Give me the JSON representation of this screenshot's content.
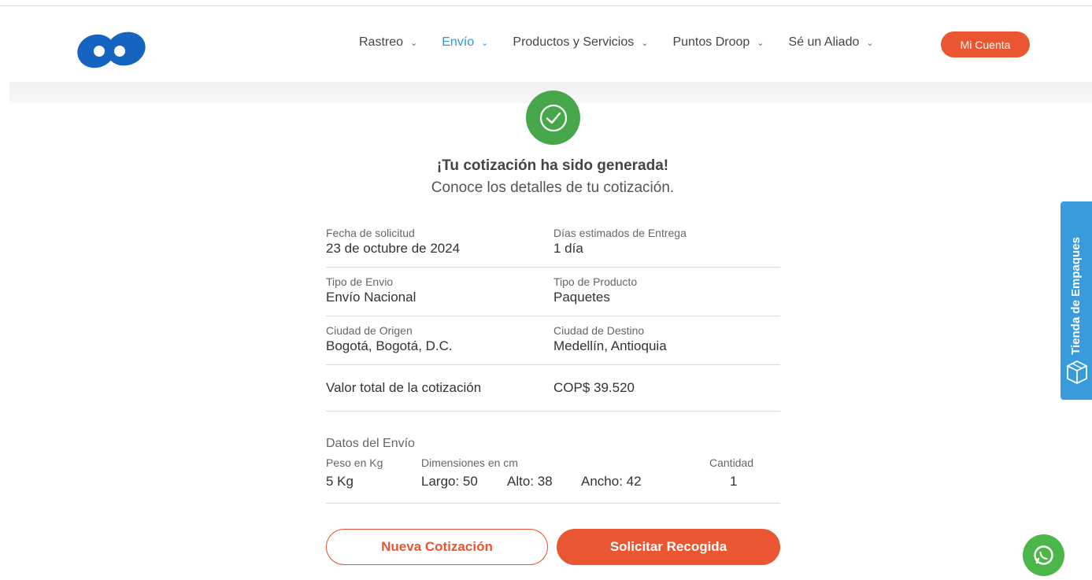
{
  "header": {
    "nav": [
      {
        "label": "Rastreo",
        "active": false
      },
      {
        "label": "Envío",
        "active": true
      },
      {
        "label": "Productos y Servicios",
        "active": false
      },
      {
        "label": "Puntos Droop",
        "active": false
      },
      {
        "label": "Sé un Aliado",
        "active": false
      }
    ],
    "account_label": "Mi Cuenta"
  },
  "confirmation": {
    "title": "¡Tu cotización ha sido generada!",
    "subtitle": "Conoce los detalles de tu cotización."
  },
  "details": {
    "request_date_label": "Fecha de solicitud",
    "request_date": "23 de octubre de 2024",
    "delivery_days_label": "Días estimados de Entrega",
    "delivery_days": "1 día",
    "shipment_type_label": "Tipo de Envio",
    "shipment_type": "Envío Nacional",
    "product_type_label": "Tipo de Producto",
    "product_type": "Paquetes",
    "origin_label": "Ciudad de Origen",
    "origin": "Bogotá, Bogotá, D.C.",
    "destination_label": "Ciudad de Destino",
    "destination": "Medellín, Antioquia",
    "total_label": "Valor total de la cotización",
    "total": "COP$ 39.520"
  },
  "shipment": {
    "section_title": "Datos del Envío",
    "weight_label": "Peso en Kg",
    "weight": "5 Kg",
    "dimensions_label": "Dimensiones en cm",
    "length": "Largo: 50",
    "height": "Alto: 38",
    "width": "Ancho: 42",
    "quantity_label": "Cantidad",
    "quantity": "1"
  },
  "actions": {
    "new_quote": "Nueva Cotización",
    "request_pickup": "Solicitar Recogida"
  },
  "side_tab": {
    "label": "Tienda de Empaques"
  },
  "colors": {
    "accent": "#ea5631",
    "brand_blue": "#1565c0",
    "success": "#46a84a",
    "side_tab": "#3a9bdc"
  },
  "icons": [
    "logo-icon",
    "chevron-down-icon",
    "check-icon",
    "box-icon",
    "whatsapp-icon"
  ]
}
